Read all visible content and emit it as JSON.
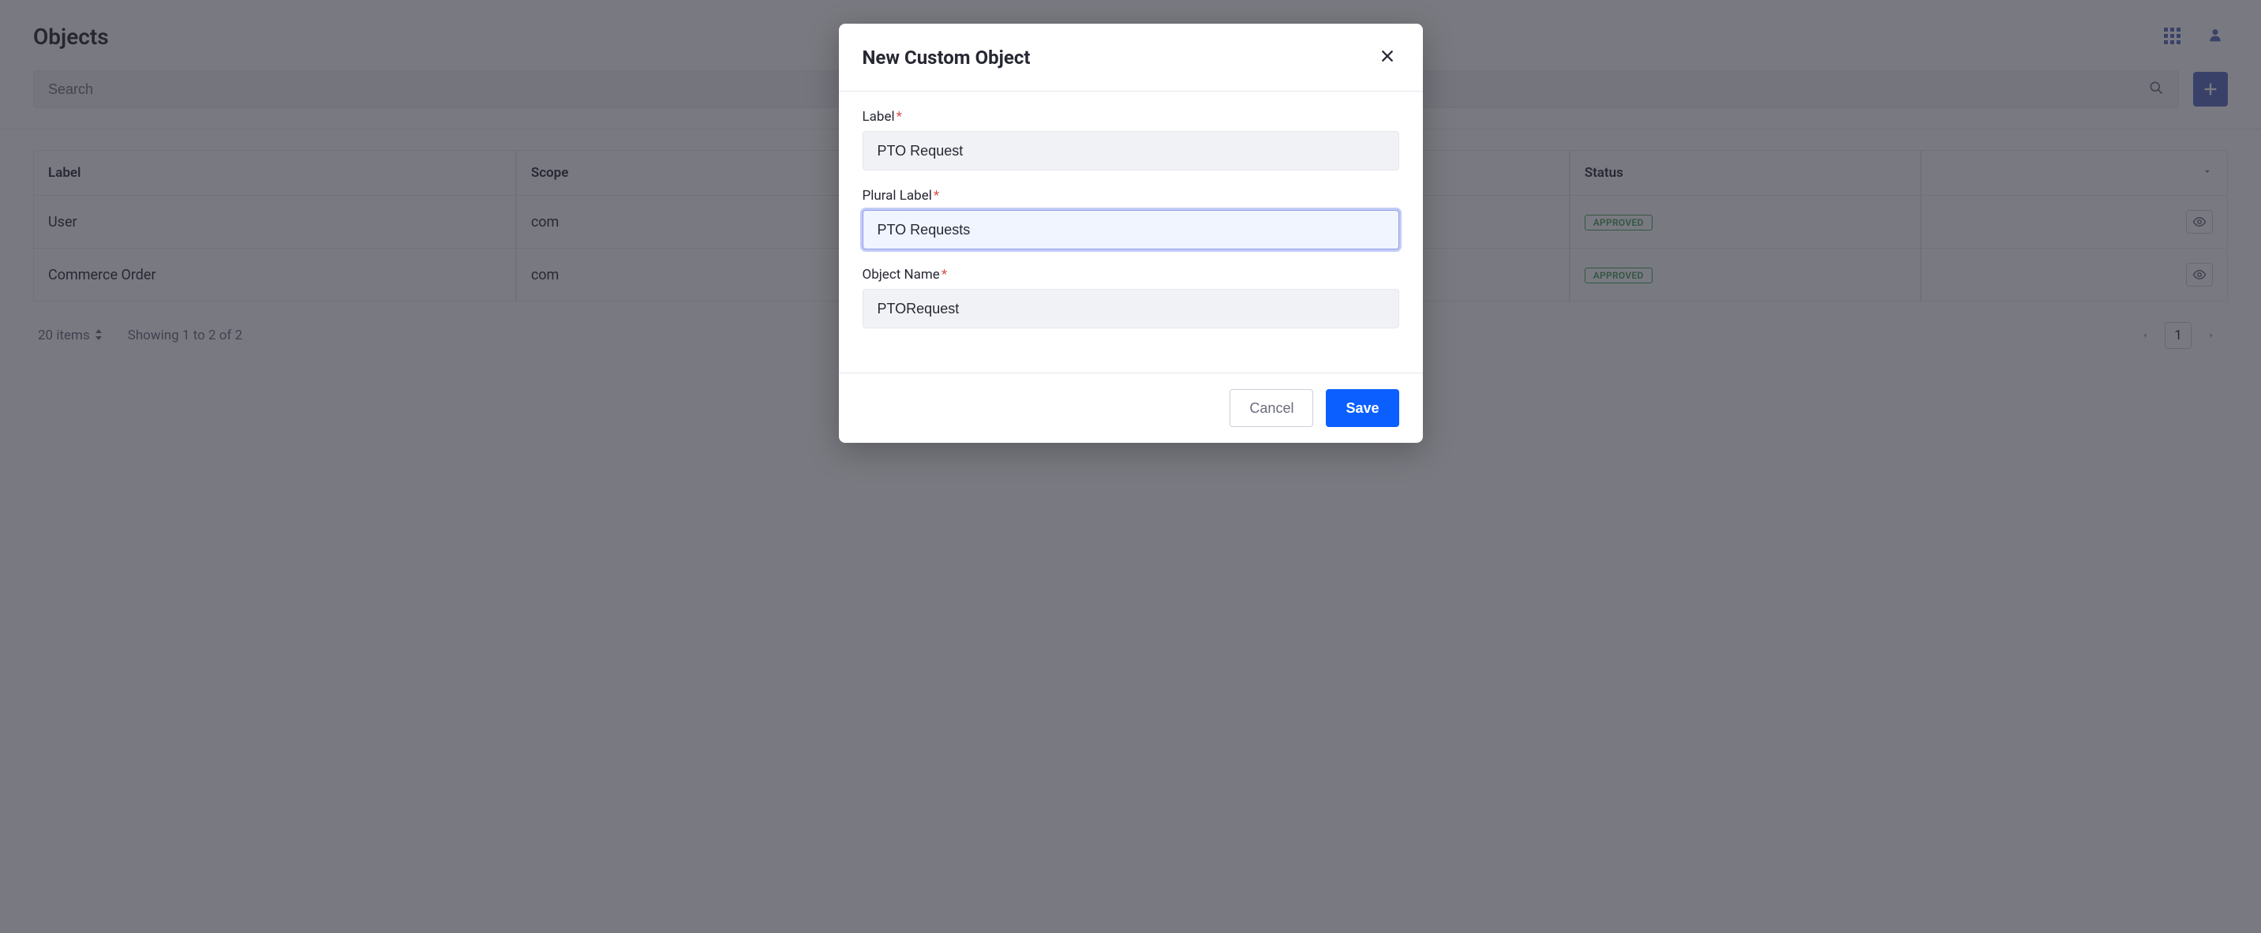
{
  "page": {
    "title": "Objects",
    "search_placeholder": "Search"
  },
  "table": {
    "columns": {
      "label": "Label",
      "scope": "Scope",
      "status": "Status"
    },
    "rows": [
      {
        "label": "User",
        "scope_prefix": "com",
        "status": "APPROVED"
      },
      {
        "label": "Commerce Order",
        "scope_prefix": "com",
        "status": "APPROVED"
      }
    ]
  },
  "footer": {
    "items_count": "20 items",
    "showing": "Showing 1 to 2 of 2",
    "page": "1"
  },
  "modal": {
    "title": "New Custom Object",
    "fields": {
      "label": {
        "label": "Label",
        "value": "PTO Request"
      },
      "plural_label": {
        "label": "Plural Label",
        "value": "PTO Requests"
      },
      "object_name": {
        "label": "Object Name",
        "value": "PTORequest"
      }
    },
    "buttons": {
      "cancel": "Cancel",
      "save": "Save"
    }
  }
}
